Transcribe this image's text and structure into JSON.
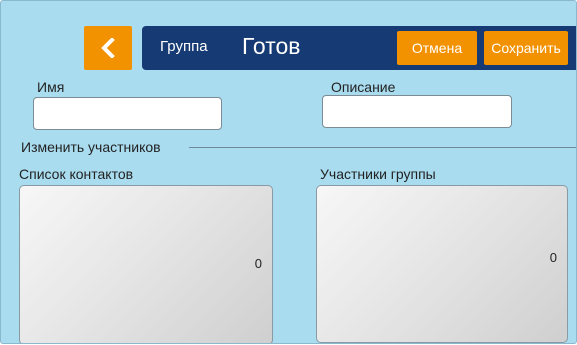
{
  "header": {
    "group_label": "Группа",
    "title": "Готов",
    "cancel_label": "Отмена",
    "save_label": "Сохранить"
  },
  "form": {
    "name_label": "Имя",
    "name_value": "",
    "description_label": "Описание",
    "description_value": ""
  },
  "members_section": {
    "heading": "Изменить участников",
    "contacts": {
      "label": "Список контактов",
      "count": "0"
    },
    "group_members": {
      "label": "Участники группы",
      "count": "0"
    }
  },
  "colors": {
    "background": "#a9dcef",
    "header": "#163a73",
    "accent": "#f39200"
  },
  "icons": {
    "back": "chevron-left-icon"
  }
}
